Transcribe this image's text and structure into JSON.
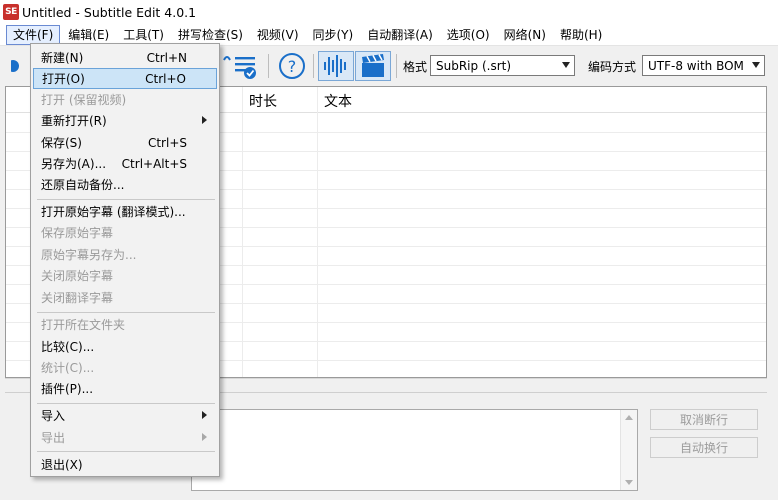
{
  "window": {
    "title": "Untitled - Subtitle Edit 4.0.1",
    "icon_text": "SE"
  },
  "menubar": [
    {
      "label": "文件(F)"
    },
    {
      "label": "编辑(E)"
    },
    {
      "label": "工具(T)"
    },
    {
      "label": "拼写检查(S)"
    },
    {
      "label": "视频(V)"
    },
    {
      "label": "同步(Y)"
    },
    {
      "label": "自动翻译(A)"
    },
    {
      "label": "选项(O)"
    },
    {
      "label": "网络(N)"
    },
    {
      "label": "帮助(H)"
    }
  ],
  "toolbar": {
    "format_label": "格式",
    "format_value": "SubRip (.srt)",
    "encoding_label": "编码方式",
    "encoding_value": "UTF-8 with BOM",
    "help_icon_text": "?"
  },
  "grid": {
    "columns": [
      "时长",
      "文本"
    ]
  },
  "buttons": {
    "unbreak": "取消断行",
    "auto_br": "自动换行"
  },
  "file_menu": [
    {
      "label": "新建(N)",
      "shortcut": "Ctrl+N"
    },
    {
      "label": "打开(O)",
      "shortcut": "Ctrl+O"
    },
    {
      "label": "打开 (保留视频)",
      "shortcut": ""
    },
    {
      "label": "重新打开(R)",
      "shortcut": ""
    },
    {
      "label": "保存(S)",
      "shortcut": "Ctrl+S"
    },
    {
      "label": "另存为(A)...",
      "shortcut": "Ctrl+Alt+S"
    },
    {
      "label": "还原自动备份...",
      "shortcut": ""
    },
    {
      "label": "打开原始字幕 (翻译模式)...",
      "shortcut": ""
    },
    {
      "label": "保存原始字幕",
      "shortcut": ""
    },
    {
      "label": "原始字幕另存为...",
      "shortcut": ""
    },
    {
      "label": "关闭原始字幕",
      "shortcut": ""
    },
    {
      "label": "关闭翻译字幕",
      "shortcut": ""
    },
    {
      "label": "打开所在文件夹",
      "shortcut": ""
    },
    {
      "label": "比较(C)...",
      "shortcut": ""
    },
    {
      "label": "统计(C)...",
      "shortcut": ""
    },
    {
      "label": "插件(P)...",
      "shortcut": ""
    },
    {
      "label": "导入",
      "shortcut": ""
    },
    {
      "label": "导出",
      "shortcut": ""
    },
    {
      "label": "退出(X)",
      "shortcut": ""
    }
  ],
  "colors": {
    "highlight": "#cce4f7",
    "accent_blue": "#1a6fc9"
  }
}
